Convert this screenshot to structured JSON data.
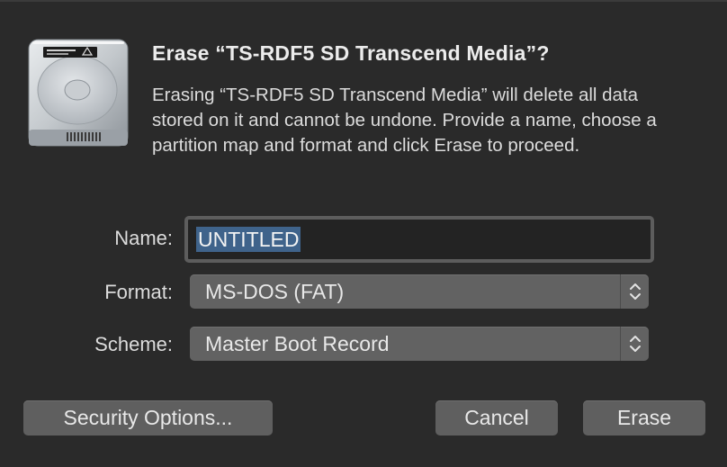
{
  "dialog": {
    "title": "Erase “TS-RDF5 SD Transcend Media”?",
    "message": "Erasing “TS-RDF5 SD Transcend Media” will delete all data stored on it and cannot be undone. Provide a name, choose a partition map and format and click Erase to proceed.",
    "icon": "external-drive-icon"
  },
  "form": {
    "name_label": "Name:",
    "name_value": "UNTITLED",
    "format_label": "Format:",
    "format_value": "MS-DOS (FAT)",
    "scheme_label": "Scheme:",
    "scheme_value": "Master Boot Record"
  },
  "buttons": {
    "security_options": "Security Options...",
    "cancel": "Cancel",
    "erase": "Erase"
  },
  "colors": {
    "background": "#2a2a2a",
    "control": "#626262",
    "selection": "#3f638b"
  }
}
